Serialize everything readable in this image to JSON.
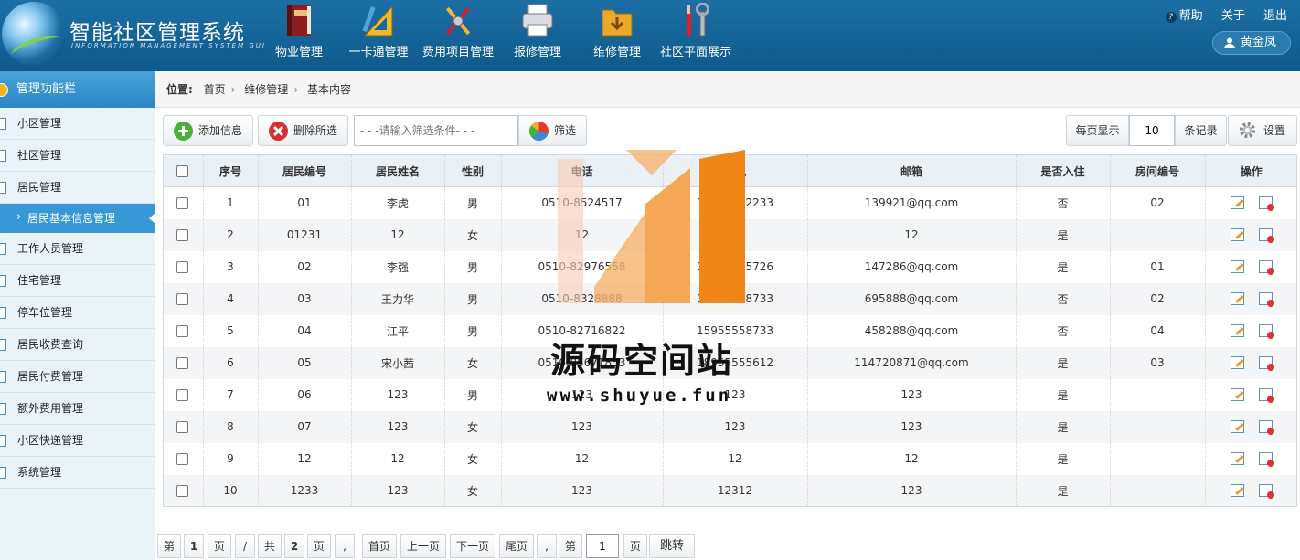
{
  "header": {
    "title": "智能社区管理系统",
    "subtitle": "INFORMATION MANAGEMENT SYSTEM GUI",
    "nav": [
      {
        "label": "物业管理",
        "icon": "book-icon"
      },
      {
        "label": "一卡通管理",
        "icon": "ruler-icon"
      },
      {
        "label": "费用项目管理",
        "icon": "tools-icon"
      },
      {
        "label": "报修管理",
        "icon": "printer-icon"
      },
      {
        "label": "维修管理",
        "icon": "folder-icon"
      },
      {
        "label": "社区平面展示",
        "icon": "wrench-icon"
      }
    ],
    "links": {
      "help": "帮助",
      "about": "关于",
      "logout": "退出"
    },
    "user": "黄金凤"
  },
  "sidebar": {
    "title": "管理功能栏",
    "items": [
      {
        "label": "小区管理"
      },
      {
        "label": "社区管理"
      },
      {
        "label": "居民管理"
      },
      {
        "label": "居民基本信息管理",
        "sub": true
      },
      {
        "label": "工作人员管理"
      },
      {
        "label": "住宅管理"
      },
      {
        "label": "停车位管理"
      },
      {
        "label": "居民收费查询"
      },
      {
        "label": "居民付费管理"
      },
      {
        "label": "额外费用管理"
      },
      {
        "label": "小区快递管理"
      },
      {
        "label": "系统管理"
      }
    ]
  },
  "breadcrumb": {
    "label": "位置:",
    "items": [
      "首页",
      "维修管理",
      "基本内容"
    ]
  },
  "toolbar": {
    "add": "添加信息",
    "delete": "删除所选",
    "filter_placeholder": "- - -请输入筛选条件- - -",
    "filter": "筛选",
    "per_page_label": "每页显示",
    "per_page": "10",
    "records": "条记录",
    "settings": "设置"
  },
  "table": {
    "headers": [
      "序号",
      "居民编号",
      "居民姓名",
      "性别",
      "电话",
      "手机",
      "邮箱",
      "是否入住",
      "房间编号",
      "操作"
    ],
    "rows": [
      [
        "1",
        "01",
        "李虎",
        "男",
        "0510-8524517",
        "13925232233",
        "139921@qq.com",
        "否",
        "02"
      ],
      [
        "2",
        "01231",
        "12",
        "女",
        "12",
        "12",
        "12",
        "是",
        ""
      ],
      [
        "3",
        "02",
        "李强",
        "男",
        "0510-82976558",
        "13925505726",
        "147286@qq.com",
        "是",
        "01"
      ],
      [
        "4",
        "03",
        "王力华",
        "男",
        "0510-8328888",
        "15935558733",
        "695888@qq.com",
        "否",
        "02"
      ],
      [
        "5",
        "04",
        "江平",
        "男",
        "0510-82716822",
        "15955558733",
        "458288@qq.com",
        "否",
        "04"
      ],
      [
        "6",
        "05",
        "宋小茜",
        "女",
        "0510-85671853",
        "18955555612",
        "114720871@qq.com",
        "是",
        "03"
      ],
      [
        "7",
        "06",
        "123",
        "男",
        "123",
        "123",
        "123",
        "是",
        ""
      ],
      [
        "8",
        "07",
        "123",
        "女",
        "123",
        "123",
        "123",
        "是",
        ""
      ],
      [
        "9",
        "12",
        "12",
        "女",
        "12",
        "12",
        "12",
        "是",
        ""
      ],
      [
        "10",
        "1233",
        "123",
        "女",
        "123",
        "12312",
        "123",
        "是",
        ""
      ]
    ]
  },
  "pager": {
    "di": "第",
    "cur": "1",
    "ye": "页",
    "slash": "/",
    "gong": "共",
    "total": "2",
    "ye2": "页",
    "comma": ",",
    "first": "首页",
    "prev": "上一页",
    "next": "下一页",
    "last": "尾页",
    "comma2": ",",
    "di2": "第",
    "jump_value": "1",
    "ye3": "页",
    "jump": "跳转"
  },
  "watermark": {
    "text": "源码空间站",
    "url": "www.shuyue.fun"
  },
  "colors": {
    "header": "#1569a0",
    "sidebar_active": "#3699d6",
    "watermark_orange": "#f28a1e"
  }
}
